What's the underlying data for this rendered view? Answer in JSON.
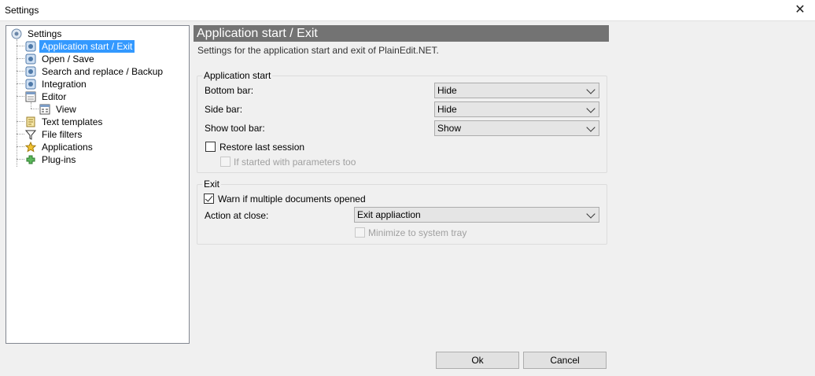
{
  "window": {
    "title": "Settings",
    "close_glyph": "✕"
  },
  "tree": {
    "root": "Settings",
    "items": [
      {
        "label": "Application start / Exit",
        "icon": "settings-page-icon",
        "selected": true
      },
      {
        "label": "Open / Save",
        "icon": "settings-page-icon"
      },
      {
        "label": "Search and replace / Backup",
        "icon": "settings-page-icon"
      },
      {
        "label": "Integration",
        "icon": "settings-page-icon"
      },
      {
        "label": "Editor",
        "icon": "editor-icon"
      },
      {
        "label": "View",
        "icon": "view-icon"
      },
      {
        "label": "Text templates",
        "icon": "template-icon"
      },
      {
        "label": "File filters",
        "icon": "filter-icon"
      },
      {
        "label": "Applications",
        "icon": "applications-icon"
      },
      {
        "label": "Plug-ins",
        "icon": "plugin-icon"
      }
    ]
  },
  "panel": {
    "title": "Application start / Exit",
    "subtitle": "Settings for the application start and exit of PlainEdit.NET."
  },
  "app_start": {
    "group_title": "Application start",
    "bottom_bar_label": "Bottom bar:",
    "bottom_bar_value": "Hide",
    "side_bar_label": "Side bar:",
    "side_bar_value": "Hide",
    "tool_bar_label": "Show tool bar:",
    "tool_bar_value": "Show",
    "restore_label": "Restore last session",
    "restore_checked": false,
    "params_label": "If started with parameters too",
    "params_checked": false
  },
  "exit": {
    "group_title": "Exit",
    "warn_label": "Warn if multiple documents opened",
    "warn_checked": true,
    "action_label": "Action at close:",
    "action_value": "Exit appliaction",
    "minimize_label": "Minimize to system tray",
    "minimize_checked": false
  },
  "buttons": {
    "ok": "Ok",
    "cancel": "Cancel"
  }
}
